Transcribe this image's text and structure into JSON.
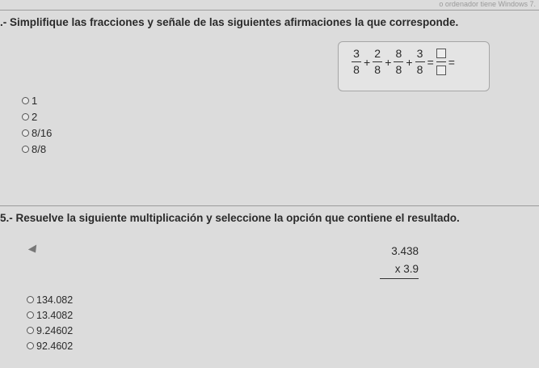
{
  "top_note": "o ordenador tiene Windows 7.",
  "q4": {
    "prefix": ".-",
    "title": "Simplifique las fracciones y señale de las siguientes afirmaciones la que corresponde.",
    "fractions": [
      {
        "num": "3",
        "den": "8"
      },
      {
        "num": "2",
        "den": "8"
      },
      {
        "num": "8",
        "den": "8"
      },
      {
        "num": "3",
        "den": "8"
      }
    ],
    "plus": "+",
    "equals": "=",
    "options": [
      "1",
      "2",
      "8/16",
      "8/8"
    ]
  },
  "q5": {
    "prefix": "5.-",
    "title": "Resuelve la siguiente multiplicación y seleccione la opción que contiene el resultado.",
    "multiplicand": "3.438",
    "multiplier": "x 3.9",
    "options": [
      "134.082",
      "13.4082",
      "9.24602",
      "92.4602"
    ]
  }
}
